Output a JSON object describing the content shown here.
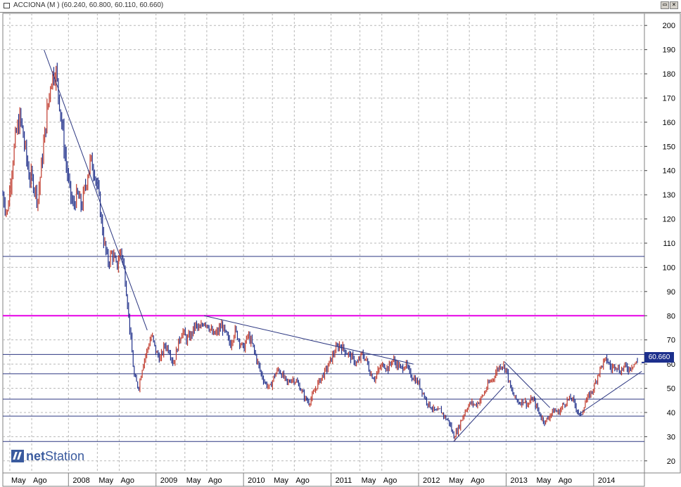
{
  "window": {
    "title": "ACCIONA (M ) (60.240, 60.800, 60.110, 60.660)",
    "restore_label": "▭",
    "close_label": "×"
  },
  "logo": {
    "prefix": "net",
    "suffix": "Station"
  },
  "price_label": "60.660",
  "colors": {
    "up": "#c0392b",
    "down": "#1f2f8a",
    "trendline": "#2b3680",
    "magenta_level": "#e600e6",
    "level": "#2b3680",
    "grid": "#b8b8b8",
    "price_tag": "#1c2f8c"
  },
  "chart_data": {
    "type": "candlestick",
    "y_axis": {
      "range": [
        15,
        205
      ],
      "ticks": [
        20,
        30,
        40,
        50,
        60,
        70,
        80,
        90,
        100,
        110,
        120,
        130,
        140,
        150,
        160,
        170,
        180,
        190,
        200
      ],
      "position": "right"
    },
    "x_axis": {
      "range": [
        2007.25,
        2014.58
      ],
      "ticks": [
        {
          "label": "May",
          "x": 2007.33
        },
        {
          "label": "Ago",
          "x": 2007.58
        },
        {
          "label": "2008",
          "x": 2008.0
        },
        {
          "label": "May",
          "x": 2008.33
        },
        {
          "label": "Ago",
          "x": 2008.58
        },
        {
          "label": "2009",
          "x": 2009.0
        },
        {
          "label": "May",
          "x": 2009.33
        },
        {
          "label": "Ago",
          "x": 2009.58
        },
        {
          "label": "2010",
          "x": 2010.0
        },
        {
          "label": "May",
          "x": 2010.33
        },
        {
          "label": "Ago",
          "x": 2010.58
        },
        {
          "label": "2011",
          "x": 2011.0
        },
        {
          "label": "May",
          "x": 2011.33
        },
        {
          "label": "Ago",
          "x": 2011.58
        },
        {
          "label": "2012",
          "x": 2012.0
        },
        {
          "label": "May",
          "x": 2012.33
        },
        {
          "label": "Ago",
          "x": 2012.58
        },
        {
          "label": "2013",
          "x": 2013.0
        },
        {
          "label": "May",
          "x": 2013.33
        },
        {
          "label": "Ago",
          "x": 2013.58
        },
        {
          "label": "2014",
          "x": 2014.0
        }
      ]
    },
    "grid": true,
    "price_path": [
      [
        2007.25,
        130
      ],
      [
        2007.3,
        122
      ],
      [
        2007.35,
        140
      ],
      [
        2007.4,
        155
      ],
      [
        2007.45,
        162
      ],
      [
        2007.5,
        150
      ],
      [
        2007.55,
        138
      ],
      [
        2007.6,
        135
      ],
      [
        2007.65,
        128
      ],
      [
        2007.7,
        145
      ],
      [
        2007.75,
        162
      ],
      [
        2007.8,
        178
      ],
      [
        2007.85,
        182
      ],
      [
        2007.9,
        168
      ],
      [
        2007.95,
        150
      ],
      [
        2008.0,
        135
      ],
      [
        2008.05,
        125
      ],
      [
        2008.1,
        130
      ],
      [
        2008.15,
        125
      ],
      [
        2008.2,
        135
      ],
      [
        2008.25,
        144
      ],
      [
        2008.3,
        140
      ],
      [
        2008.35,
        128
      ],
      [
        2008.4,
        112
      ],
      [
        2008.45,
        102
      ],
      [
        2008.5,
        106
      ],
      [
        2008.55,
        100
      ],
      [
        2008.6,
        108
      ],
      [
        2008.65,
        95
      ],
      [
        2008.7,
        75
      ],
      [
        2008.75,
        55
      ],
      [
        2008.8,
        50
      ],
      [
        2008.85,
        60
      ],
      [
        2008.9,
        66
      ],
      [
        2008.95,
        72
      ],
      [
        2009.0,
        65
      ],
      [
        2009.05,
        62
      ],
      [
        2009.1,
        68
      ],
      [
        2009.15,
        66
      ],
      [
        2009.2,
        60
      ],
      [
        2009.25,
        68
      ],
      [
        2009.3,
        74
      ],
      [
        2009.35,
        70
      ],
      [
        2009.4,
        72
      ],
      [
        2009.45,
        76
      ],
      [
        2009.5,
        74
      ],
      [
        2009.55,
        78
      ],
      [
        2009.6,
        76
      ],
      [
        2009.65,
        72
      ],
      [
        2009.7,
        73
      ],
      [
        2009.75,
        76
      ],
      [
        2009.8,
        72
      ],
      [
        2009.85,
        68
      ],
      [
        2009.9,
        74
      ],
      [
        2009.95,
        70
      ],
      [
        2010.0,
        66
      ],
      [
        2010.05,
        72
      ],
      [
        2010.1,
        68
      ],
      [
        2010.15,
        62
      ],
      [
        2010.2,
        56
      ],
      [
        2010.25,
        52
      ],
      [
        2010.3,
        50
      ],
      [
        2010.35,
        55
      ],
      [
        2010.4,
        58
      ],
      [
        2010.45,
        55
      ],
      [
        2010.5,
        52
      ],
      [
        2010.55,
        54
      ],
      [
        2010.6,
        53
      ],
      [
        2010.65,
        50
      ],
      [
        2010.7,
        46
      ],
      [
        2010.75,
        44
      ],
      [
        2010.8,
        48
      ],
      [
        2010.85,
        52
      ],
      [
        2010.9,
        55
      ],
      [
        2010.95,
        58
      ],
      [
        2011.0,
        62
      ],
      [
        2011.05,
        66
      ],
      [
        2011.1,
        68
      ],
      [
        2011.15,
        66
      ],
      [
        2011.2,
        64
      ],
      [
        2011.25,
        62
      ],
      [
        2011.3,
        60
      ],
      [
        2011.35,
        64
      ],
      [
        2011.4,
        62
      ],
      [
        2011.45,
        56
      ],
      [
        2011.5,
        54
      ],
      [
        2011.55,
        58
      ],
      [
        2011.6,
        60
      ],
      [
        2011.65,
        58
      ],
      [
        2011.7,
        62
      ],
      [
        2011.75,
        60
      ],
      [
        2011.8,
        58
      ],
      [
        2011.85,
        60
      ],
      [
        2011.9,
        56
      ],
      [
        2011.95,
        54
      ],
      [
        2012.0,
        52
      ],
      [
        2012.05,
        48
      ],
      [
        2012.1,
        44
      ],
      [
        2012.15,
        42
      ],
      [
        2012.2,
        40
      ],
      [
        2012.25,
        41
      ],
      [
        2012.3,
        38
      ],
      [
        2012.35,
        36
      ],
      [
        2012.4,
        30
      ],
      [
        2012.45,
        33
      ],
      [
        2012.5,
        38
      ],
      [
        2012.55,
        42
      ],
      [
        2012.6,
        44
      ],
      [
        2012.65,
        43
      ],
      [
        2012.7,
        45
      ],
      [
        2012.75,
        48
      ],
      [
        2012.8,
        52
      ],
      [
        2012.85,
        54
      ],
      [
        2012.9,
        58
      ],
      [
        2012.95,
        60
      ],
      [
        2013.0,
        58
      ],
      [
        2013.05,
        50
      ],
      [
        2013.1,
        46
      ],
      [
        2013.15,
        44
      ],
      [
        2013.2,
        45
      ],
      [
        2013.25,
        43
      ],
      [
        2013.3,
        46
      ],
      [
        2013.35,
        42
      ],
      [
        2013.4,
        38
      ],
      [
        2013.45,
        36
      ],
      [
        2013.5,
        39
      ],
      [
        2013.55,
        41
      ],
      [
        2013.6,
        40
      ],
      [
        2013.65,
        43
      ],
      [
        2013.7,
        45
      ],
      [
        2013.75,
        46
      ],
      [
        2013.8,
        42
      ],
      [
        2013.85,
        38
      ],
      [
        2013.9,
        44
      ],
      [
        2013.95,
        47
      ],
      [
        2014.0,
        50
      ],
      [
        2014.05,
        56
      ],
      [
        2014.1,
        60
      ],
      [
        2014.15,
        62
      ],
      [
        2014.2,
        58
      ],
      [
        2014.25,
        60
      ],
      [
        2014.3,
        57
      ],
      [
        2014.35,
        59
      ],
      [
        2014.4,
        58
      ],
      [
        2014.45,
        60
      ],
      [
        2014.5,
        60.66
      ]
    ],
    "horizontal_levels": [
      {
        "y": 104.5,
        "color": "level"
      },
      {
        "y": 80,
        "color": "magenta_level"
      },
      {
        "y": 64,
        "color": "level"
      },
      {
        "y": 56,
        "color": "level"
      },
      {
        "y": 45.5,
        "color": "level"
      },
      {
        "y": 38.5,
        "color": "level"
      },
      {
        "y": 28,
        "color": "level"
      }
    ],
    "trendlines": [
      [
        [
          2007.72,
          190
        ],
        [
          2008.9,
          74
        ]
      ],
      [
        [
          2009.55,
          80
        ],
        [
          2011.94,
          60
        ]
      ],
      [
        [
          2012.4,
          28
        ],
        [
          2012.98,
          51
        ]
      ],
      [
        [
          2012.98,
          61
        ],
        [
          2013.5,
          42
        ]
      ],
      [
        [
          2013.82,
          39
        ],
        [
          2014.55,
          57
        ]
      ]
    ],
    "last_value": 60.66
  }
}
